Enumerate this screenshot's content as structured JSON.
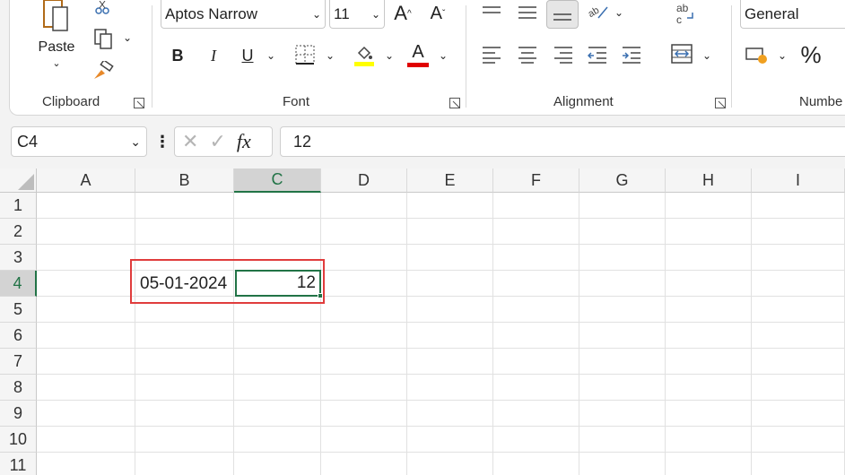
{
  "ribbon": {
    "clipboard": {
      "paste_label": "Paste",
      "group_label": "Clipboard"
    },
    "font": {
      "font_name": "Aptos Narrow",
      "font_size": "11",
      "bold": "B",
      "italic": "I",
      "underline": "U",
      "increase_size": "A",
      "decrease_size": "A",
      "font_color_letter": "A",
      "highlight_color": "#ffff00",
      "font_color": "#e00000",
      "group_label": "Font"
    },
    "alignment": {
      "group_label": "Alignment"
    },
    "number": {
      "format": "General",
      "percent": "%",
      "group_label": "Numbe"
    }
  },
  "formula_bar": {
    "name_box": "C4",
    "fx": "fx",
    "value": "12"
  },
  "columns": [
    "A",
    "B",
    "C",
    "D",
    "E",
    "F",
    "G",
    "H",
    "I"
  ],
  "rows": [
    "1",
    "2",
    "3",
    "4",
    "5",
    "6",
    "7",
    "8",
    "9",
    "10",
    "11"
  ],
  "cells": {
    "B4": "05-01-2024",
    "C4": "12"
  },
  "colors": {
    "accent_green": "#217346",
    "annotation_red": "#e03c3c"
  }
}
